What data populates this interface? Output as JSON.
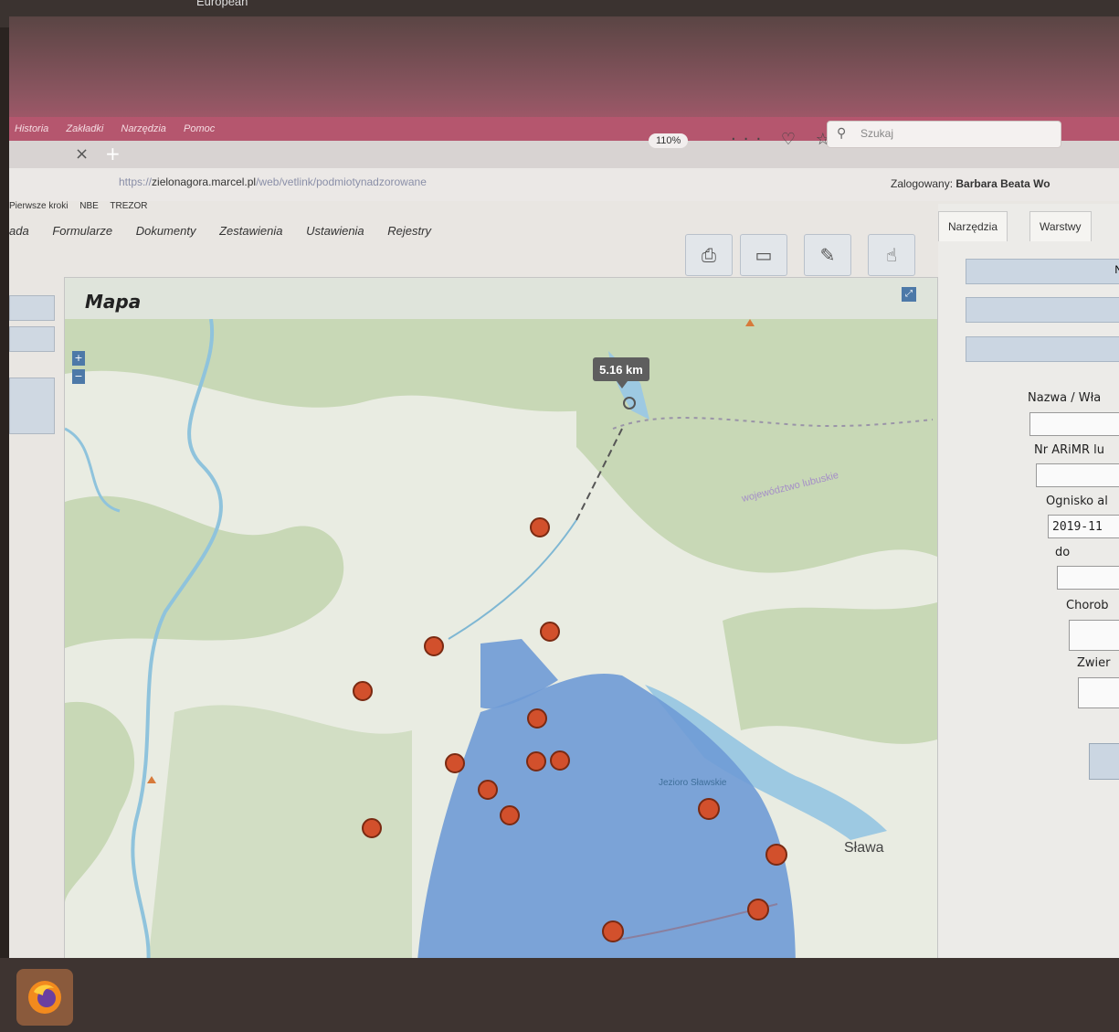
{
  "corner_text": "European",
  "browser": {
    "menu": [
      "Historia",
      "Zakładki",
      "Narzędzia",
      "Pomoc"
    ],
    "tab_close": "×",
    "tab_new": "+",
    "url_prefix": "https://",
    "url_host": "zielonagora.marcel.pl",
    "url_path": "/web/vetlink/podmiotynadzorowane",
    "zoom": "110%",
    "nav_icons": "··· ♡ ☆",
    "search_placeholder": "Szukaj"
  },
  "bookmarks": [
    "Pierwsze kroki",
    "NBE",
    "TREZOR"
  ],
  "logged_in": {
    "label": "Zalogowany:",
    "user": "Barbara Beata Wo"
  },
  "app_menu": [
    "ada",
    "Formularze",
    "Dokumenty",
    "Zestawienia",
    "Ustawienia",
    "Rejestry"
  ],
  "toolbar_icons": [
    "print-icon",
    "ruler-icon",
    "pencil-icon",
    "hand-icon"
  ],
  "map": {
    "title": "Mapa",
    "zoom_in": "+",
    "zoom_out": "−",
    "measurement": "5.16 km",
    "label_region": "województwo lubuskie",
    "label_town": "Sława",
    "label_lake": "Jezioro Sławskie",
    "colors": {
      "marker": "#d2502c",
      "zone": "#6f9bd6",
      "forest": "#c8d8b6",
      "water": "#9dc9e2"
    },
    "markers": [
      {
        "id": 1
      },
      {
        "id": 2
      },
      {
        "id": 3
      },
      {
        "id": 4
      },
      {
        "id": 5
      },
      {
        "id": 6
      },
      {
        "id": 7
      },
      {
        "id": 8
      },
      {
        "id": 9
      },
      {
        "id": 10
      },
      {
        "id": 11
      },
      {
        "id": 12
      },
      {
        "id": 13
      },
      {
        "id": 14
      },
      {
        "id": 15
      }
    ]
  },
  "right_panel": {
    "tabs": [
      "Narzędzia",
      "Warstwy"
    ],
    "button_partial": "N",
    "fields": [
      {
        "label": "Nazwa / Wła",
        "value": ""
      },
      {
        "label": "Nr ARiMR lu",
        "value": ""
      },
      {
        "label": "Ognisko al",
        "value": "2019-11"
      },
      {
        "label": "do",
        "value": ""
      },
      {
        "label": "Chorob",
        "value": ""
      },
      {
        "label": "Zwier",
        "value": ""
      }
    ]
  }
}
